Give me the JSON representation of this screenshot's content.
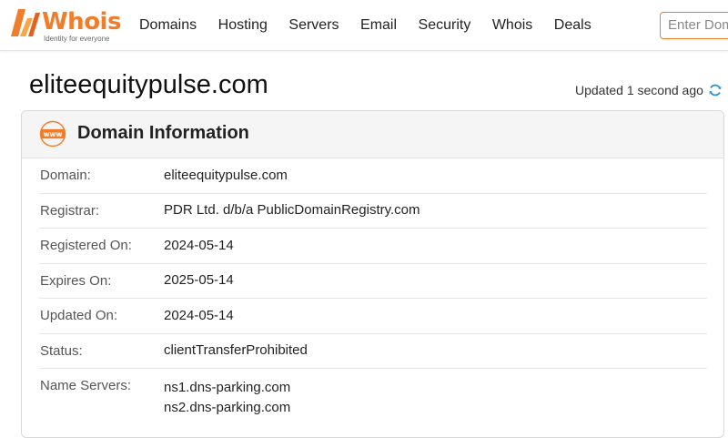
{
  "header": {
    "logo_text": "Whois",
    "logo_tagline": "Identity for everyone",
    "nav": [
      "Domains",
      "Hosting",
      "Servers",
      "Email",
      "Security",
      "Whois",
      "Deals"
    ],
    "search_placeholder": "Enter Domain"
  },
  "page": {
    "title": "eliteequitypulse.com",
    "updated_text": "Updated 1 second ago"
  },
  "card": {
    "title": "Domain Information",
    "rows": [
      {
        "label": "Domain:",
        "value": "eliteequitypulse.com"
      },
      {
        "label": "Registrar:",
        "value": "PDR Ltd. d/b/a PublicDomainRegistry.com"
      },
      {
        "label": "Registered On:",
        "value": "2024-05-14"
      },
      {
        "label": "Expires On:",
        "value": "2025-05-14"
      },
      {
        "label": "Updated On:",
        "value": "2024-05-14"
      },
      {
        "label": "Status:",
        "value": "clientTransferProhibited"
      }
    ],
    "name_servers": {
      "label": "Name Servers:",
      "values": [
        "ns1.dns-parking.com",
        "ns2.dns-parking.com"
      ]
    }
  },
  "colors": {
    "brand_orange": "#f07d2a",
    "refresh_blue": "#2a8fd6"
  },
  "icons": {
    "logo": "whois-logo-icon",
    "refresh": "refresh-icon",
    "card": "www-globe-icon"
  }
}
